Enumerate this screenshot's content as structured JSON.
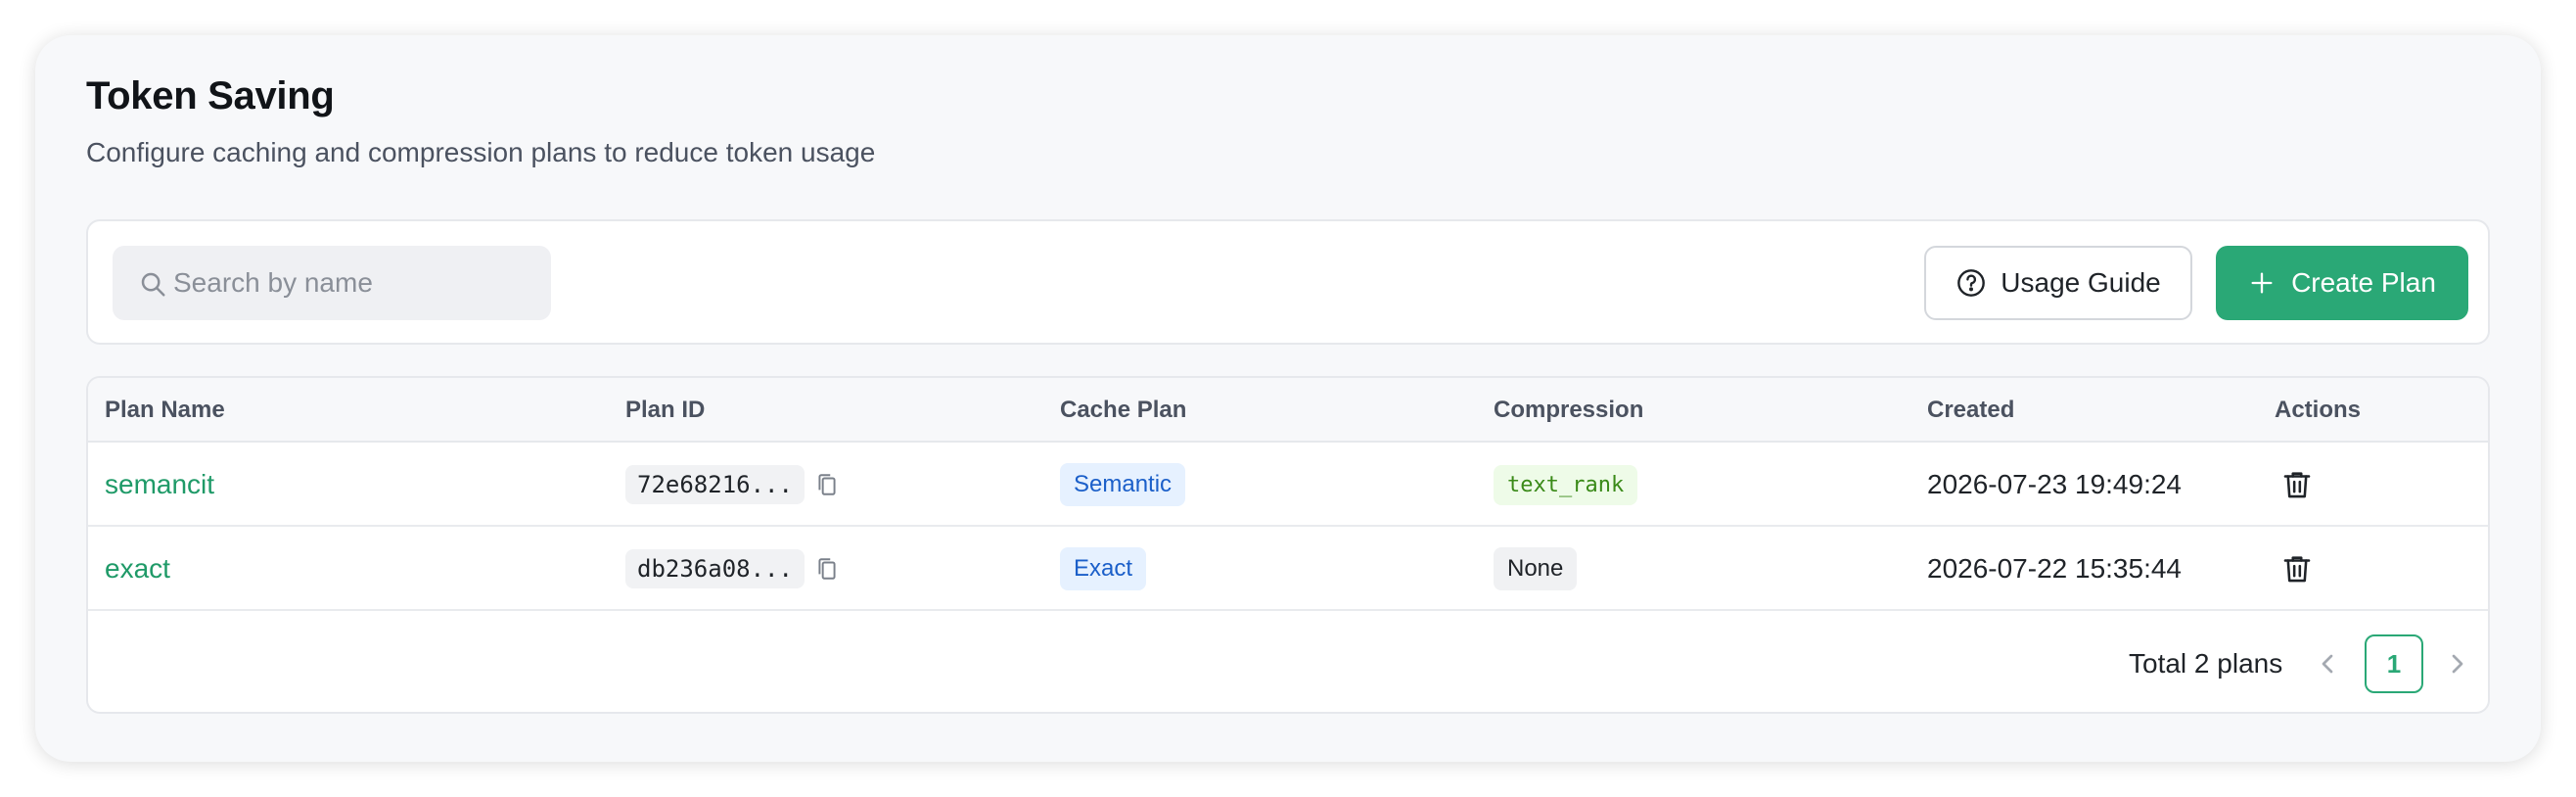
{
  "header": {
    "title": "Token Saving",
    "subtitle": "Configure caching and compression plans to reduce token usage"
  },
  "toolbar": {
    "search_placeholder": "Search by name",
    "usage_guide_label": "Usage Guide",
    "create_plan_label": "Create Plan"
  },
  "table": {
    "columns": [
      "Plan Name",
      "Plan ID",
      "Cache Plan",
      "Compression",
      "Created",
      "Actions"
    ],
    "rows": [
      {
        "name": "semancit",
        "id": "72e68216...",
        "cache_plan": "Semantic",
        "compression": "text_rank",
        "created": "2026-07-23 19:49:24"
      },
      {
        "name": "exact",
        "id": "db236a08...",
        "cache_plan": "Exact",
        "compression": "None",
        "created": "2026-07-22 15:35:44"
      }
    ]
  },
  "pagination": {
    "total_label": "Total 2 plans",
    "current_page": "1"
  },
  "colors": {
    "accent": "#2aa876",
    "link": "#1f9a68",
    "tag_blue_bg": "#e6f1ff",
    "tag_green_bg": "#eefbe8"
  },
  "icons": {
    "search": "search-icon",
    "help": "question-circle-icon",
    "add": "plus-icon",
    "copy": "copy-icon",
    "delete": "trash-icon",
    "prev": "chevron-left-icon",
    "next": "chevron-right-icon"
  }
}
